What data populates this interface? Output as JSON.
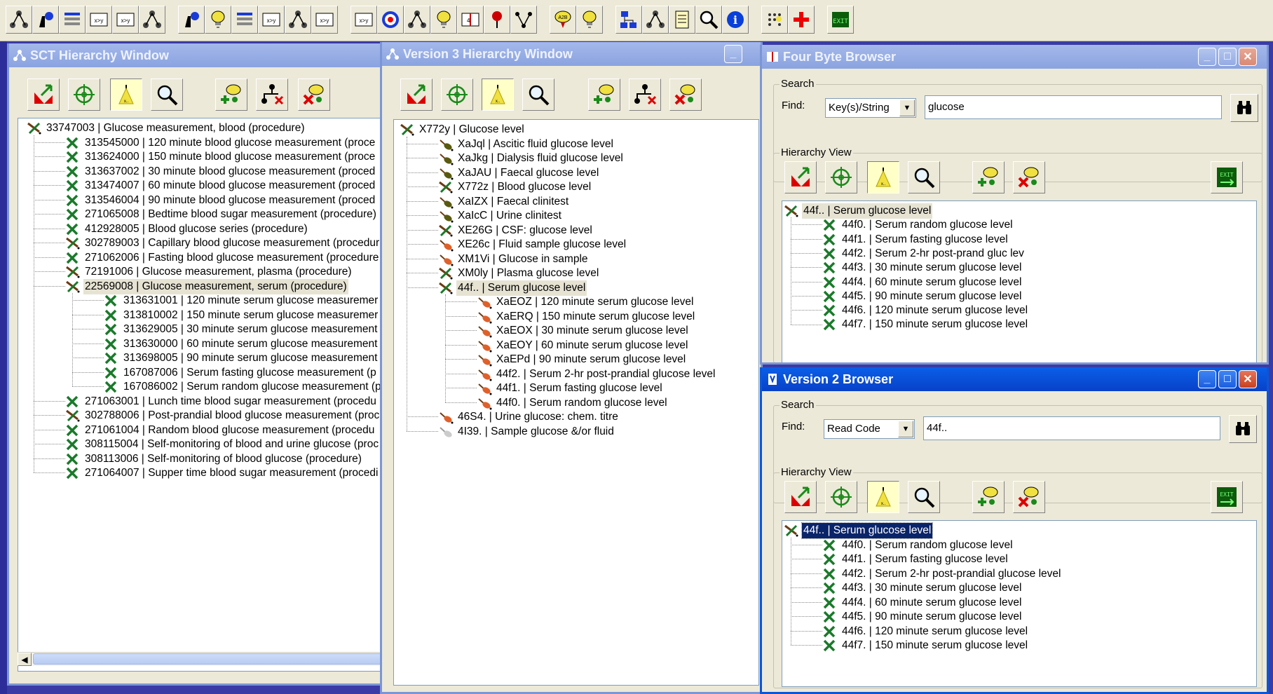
{
  "main_toolbar": {
    "buttons": [
      {
        "icon": "sct-hierarchy-icon"
      },
      {
        "icon": "sct-find-icon"
      },
      {
        "icon": "sct-list-icon"
      },
      {
        "icon": "map-xy-icon"
      },
      {
        "icon": "map-xy-bracket-icon"
      },
      {
        "icon": "tree-icon"
      },
      {
        "icon": "version3-find-icon"
      },
      {
        "icon": "version3-bulb-icon"
      },
      {
        "icon": "version3-list-icon"
      },
      {
        "icon": "version3-map-icon"
      },
      {
        "icon": "version3-tree-icon"
      },
      {
        "icon": "chat-map-icon"
      },
      {
        "icon": "chat-map-2-icon"
      },
      {
        "icon": "target-icon"
      },
      {
        "icon": "v2-hierarchy-icon"
      },
      {
        "icon": "v2-bulb-icon"
      },
      {
        "icon": "book-icon"
      },
      {
        "icon": "v2-pin-icon"
      },
      {
        "icon": "branch-icon"
      },
      {
        "icon": "a2b-icon"
      },
      {
        "icon": "multi-bulb-icon"
      },
      {
        "icon": "network-icon"
      },
      {
        "icon": "hierarchy-small-icon"
      },
      {
        "icon": "notes-icon"
      },
      {
        "icon": "magnifier-icon"
      },
      {
        "icon": "info-icon"
      },
      {
        "icon": "grid-icon"
      },
      {
        "icon": "plus-icon"
      },
      {
        "icon": "exit-icon"
      }
    ]
  },
  "sct_window": {
    "title": "SCT Hierarchy Window",
    "tree": [
      {
        "label": "33747003 | Glucose measurement, blood (procedure)",
        "level": 0,
        "icon": "brown"
      },
      {
        "label": "313545000 | 120 minute blood glucose measurement (proce",
        "level": 1,
        "icon": "green"
      },
      {
        "label": "313624000 | 150 minute blood glucose measurement (proce",
        "level": 1,
        "icon": "green"
      },
      {
        "label": "313637002 | 30 minute blood glucose measurement (proced",
        "level": 1,
        "icon": "green"
      },
      {
        "label": "313474007 | 60 minute blood glucose measurement (proced",
        "level": 1,
        "icon": "green"
      },
      {
        "label": "313546004 | 90 minute blood glucose measurement (proced",
        "level": 1,
        "icon": "green"
      },
      {
        "label": "271065008 | Bedtime blood sugar measurement (procedure)",
        "level": 1,
        "icon": "green"
      },
      {
        "label": "412928005 | Blood glucose series (procedure)",
        "level": 1,
        "icon": "green"
      },
      {
        "label": "302789003 | Capillary blood glucose measurement (procedur",
        "level": 1,
        "icon": "brown"
      },
      {
        "label": "271062006 | Fasting blood glucose measurement (procedure",
        "level": 1,
        "icon": "green"
      },
      {
        "label": "72191006 | Glucose measurement, plasma (procedure)",
        "level": 1,
        "icon": "brown"
      },
      {
        "label": "22569008 | Glucose measurement, serum (procedure)",
        "level": 1,
        "icon": "brown",
        "selected": true
      },
      {
        "label": "313631001 | 120 minute serum glucose measuremer",
        "level": 2,
        "icon": "green"
      },
      {
        "label": "313810002 | 150 minute serum glucose measuremer",
        "level": 2,
        "icon": "green"
      },
      {
        "label": "313629005 | 30 minute serum glucose measurement",
        "level": 2,
        "icon": "green"
      },
      {
        "label": "313630000 | 60 minute serum glucose measurement",
        "level": 2,
        "icon": "green"
      },
      {
        "label": "313698005 | 90 minute serum glucose measurement",
        "level": 2,
        "icon": "green"
      },
      {
        "label": "167087006 | Serum fasting glucose measurement (p",
        "level": 2,
        "icon": "green"
      },
      {
        "label": "167086002 | Serum random glucose measurement (p",
        "level": 2,
        "icon": "green"
      },
      {
        "label": "271063001 | Lunch time blood sugar measurement (procedu",
        "level": 1,
        "icon": "green"
      },
      {
        "label": "302788006 | Post-prandial blood glucose measurement (proc",
        "level": 1,
        "icon": "brown"
      },
      {
        "label": "271061004 | Random blood glucose measurement (procedu",
        "level": 1,
        "icon": "green"
      },
      {
        "label": "308115004 | Self-monitoring of blood and urine glucose (proc",
        "level": 1,
        "icon": "green"
      },
      {
        "label": "308113006 | Self-monitoring of blood glucose (procedure)",
        "level": 1,
        "icon": "green"
      },
      {
        "label": "271064007 | Supper time blood sugar measurement (procedi",
        "level": 1,
        "icon": "green"
      }
    ]
  },
  "v3_window": {
    "title": "Version 3 Hierarchy Window",
    "tree": [
      {
        "label": "X772y | Glucose level",
        "level": 0,
        "icon": "brown"
      },
      {
        "label": "XaJql | Ascitic fluid glucose level",
        "level": 1,
        "icon": "olive"
      },
      {
        "label": "XaJkg | Dialysis fluid glucose level",
        "level": 1,
        "icon": "olive"
      },
      {
        "label": "XaJAU | Faecal glucose level",
        "level": 1,
        "icon": "olive"
      },
      {
        "label": "X772z | Blood glucose level",
        "level": 1,
        "icon": "brown"
      },
      {
        "label": "XaIZX | Faecal clinitest",
        "level": 1,
        "icon": "olive"
      },
      {
        "label": "XaIcC | Urine clinitest",
        "level": 1,
        "icon": "olive"
      },
      {
        "label": "XE26G | CSF: glucose level",
        "level": 1,
        "icon": "brown"
      },
      {
        "label": "XE26c | Fluid sample glucose level",
        "level": 1,
        "icon": "orange"
      },
      {
        "label": "XM1Vi | Glucose in sample",
        "level": 1,
        "icon": "orange"
      },
      {
        "label": "XM0ly | Plasma glucose level",
        "level": 1,
        "icon": "brown"
      },
      {
        "label": "44f.. | Serum glucose level",
        "level": 1,
        "icon": "brown",
        "selected": true
      },
      {
        "label": "XaEOZ | 120 minute serum glucose level",
        "level": 2,
        "icon": "orange"
      },
      {
        "label": "XaERQ | 150 minute serum glucose level",
        "level": 2,
        "icon": "orange"
      },
      {
        "label": "XaEOX | 30 minute serum glucose level",
        "level": 2,
        "icon": "orange"
      },
      {
        "label": "XaEOY | 60 minute serum glucose level",
        "level": 2,
        "icon": "orange"
      },
      {
        "label": "XaEPd | 90 minute serum glucose level",
        "level": 2,
        "icon": "orange"
      },
      {
        "label": "44f2. | Serum 2-hr post-prandial glucose level",
        "level": 2,
        "icon": "orange"
      },
      {
        "label": "44f1. | Serum fasting glucose level",
        "level": 2,
        "icon": "orange"
      },
      {
        "label": "44f0. | Serum random glucose level",
        "level": 2,
        "icon": "orange"
      },
      {
        "label": "46S4. | Urine glucose: chem. titre",
        "level": 1,
        "icon": "orange"
      },
      {
        "label": "4I39. | Sample glucose &/or fluid",
        "level": 1,
        "icon": "grey"
      }
    ]
  },
  "fourbyte_window": {
    "title": "Four Byte Browser",
    "search_legend": "Search",
    "find_label": "Find:",
    "find_mode": "Key(s)/String",
    "find_value": "glucose",
    "hierarchy_legend": "Hierarchy View",
    "tree": [
      {
        "label": "44f.. | Serum glucose level",
        "level": 0,
        "icon": "brown",
        "selected": true
      },
      {
        "label": "44f0. | Serum random glucose level",
        "level": 1,
        "icon": "green"
      },
      {
        "label": "44f1. | Serum fasting glucose level",
        "level": 1,
        "icon": "green"
      },
      {
        "label": "44f2. | Serum 2-hr post-prand gluc lev",
        "level": 1,
        "icon": "green"
      },
      {
        "label": "44f3. | 30 minute serum glucose level",
        "level": 1,
        "icon": "green"
      },
      {
        "label": "44f4. | 60 minute serum glucose level",
        "level": 1,
        "icon": "green"
      },
      {
        "label": "44f5. | 90 minute serum glucose level",
        "level": 1,
        "icon": "green"
      },
      {
        "label": "44f6. | 120 minute serum glucose level",
        "level": 1,
        "icon": "green"
      },
      {
        "label": "44f7. | 150 minute serum glucose level",
        "level": 1,
        "icon": "green"
      }
    ]
  },
  "v2_window": {
    "title": "Version 2 Browser",
    "search_legend": "Search",
    "find_label": "Find:",
    "find_mode": "Read Code",
    "find_value": "44f..",
    "hierarchy_legend": "Hierarchy View",
    "tree": [
      {
        "label": "44f.. | Serum glucose level",
        "level": 0,
        "icon": "brown",
        "highlight": true
      },
      {
        "label": "44f0. | Serum random glucose level",
        "level": 1,
        "icon": "green"
      },
      {
        "label": "44f1. | Serum fasting glucose level",
        "level": 1,
        "icon": "green"
      },
      {
        "label": "44f2. | Serum 2-hr post-prandial glucose level",
        "level": 1,
        "icon": "green"
      },
      {
        "label": "44f3. | 30 minute serum glucose level",
        "level": 1,
        "icon": "green"
      },
      {
        "label": "44f4. | 60 minute serum glucose level",
        "level": 1,
        "icon": "green"
      },
      {
        "label": "44f5. | 90 minute serum glucose level",
        "level": 1,
        "icon": "green"
      },
      {
        "label": "44f6. | 120 minute serum glucose level",
        "level": 1,
        "icon": "green"
      },
      {
        "label": "44f7. | 150 minute serum glucose level",
        "level": 1,
        "icon": "green"
      }
    ]
  },
  "window_tools": {
    "sct": [
      "go-to-top-icon",
      "crosshair-icon",
      "bulb-pressed-icon",
      "magnifier-icon",
      "add-node-icon",
      "remove-branch-icon",
      "delete-node-icon"
    ],
    "v3": [
      "go-to-top-icon",
      "crosshair-icon",
      "bulb-pressed-icon",
      "magnifier-icon",
      "add-bulb-icon",
      "remove-branch-icon",
      "delete-bulb-icon"
    ],
    "fourbyte": [
      "go-to-top-icon",
      "crosshair-icon",
      "bulb-pressed-icon",
      "magnifier-icon",
      "add-bulb-icon",
      "delete-bulb-icon",
      "exit-icon"
    ],
    "v2": [
      "go-to-top-icon",
      "crosshair-icon",
      "bulb-pressed-icon",
      "magnifier-icon",
      "add-bulb-icon",
      "delete-bulb-icon",
      "exit-icon"
    ]
  },
  "colors": {
    "titlebar_active": "#0a56d8",
    "titlebar_inactive": "#8aa3e0",
    "desktop": "#3b3ba6",
    "selection": "#0a246a"
  }
}
